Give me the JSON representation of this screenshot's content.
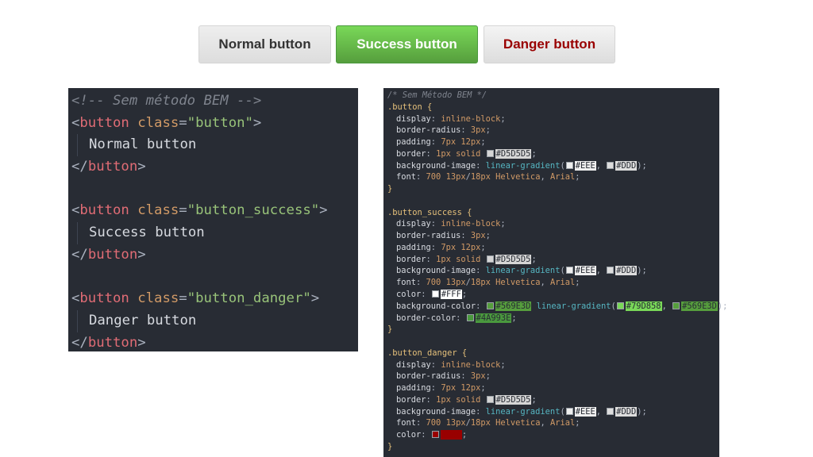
{
  "buttons": {
    "normal": "Normal button",
    "success": "Success button",
    "danger": "Danger button"
  },
  "html_code": [
    {
      "indent": false,
      "parts": [
        {
          "c": "c-comment",
          "t": "<!-- Sem método BEM -->"
        }
      ]
    },
    {
      "indent": false,
      "parts": [
        {
          "c": "c-punct",
          "t": "<"
        },
        {
          "c": "c-tag",
          "t": "button"
        },
        {
          "c": "c-text",
          "t": " "
        },
        {
          "c": "c-attr",
          "t": "class"
        },
        {
          "c": "c-punct",
          "t": "="
        },
        {
          "c": "c-str",
          "t": "\"button\""
        },
        {
          "c": "c-punct",
          "t": ">"
        }
      ]
    },
    {
      "indent": true,
      "parts": [
        {
          "c": "c-text",
          "t": "Normal button"
        }
      ]
    },
    {
      "indent": false,
      "parts": [
        {
          "c": "c-punct",
          "t": "</"
        },
        {
          "c": "c-tag",
          "t": "button"
        },
        {
          "c": "c-punct",
          "t": ">"
        }
      ]
    },
    {
      "indent": false,
      "parts": []
    },
    {
      "indent": false,
      "parts": [
        {
          "c": "c-punct",
          "t": "<"
        },
        {
          "c": "c-tag",
          "t": "button"
        },
        {
          "c": "c-text",
          "t": " "
        },
        {
          "c": "c-attr",
          "t": "class"
        },
        {
          "c": "c-punct",
          "t": "="
        },
        {
          "c": "c-str",
          "t": "\"button_success\""
        },
        {
          "c": "c-punct",
          "t": ">"
        }
      ]
    },
    {
      "indent": true,
      "parts": [
        {
          "c": "c-text",
          "t": "Success button"
        }
      ]
    },
    {
      "indent": false,
      "parts": [
        {
          "c": "c-punct",
          "t": "</"
        },
        {
          "c": "c-tag",
          "t": "button"
        },
        {
          "c": "c-punct",
          "t": ">"
        }
      ]
    },
    {
      "indent": false,
      "parts": []
    },
    {
      "indent": false,
      "parts": [
        {
          "c": "c-punct",
          "t": "<"
        },
        {
          "c": "c-tag",
          "t": "button"
        },
        {
          "c": "c-text",
          "t": " "
        },
        {
          "c": "c-attr",
          "t": "class"
        },
        {
          "c": "c-punct",
          "t": "="
        },
        {
          "c": "c-str",
          "t": "\"button_danger\""
        },
        {
          "c": "c-punct",
          "t": ">"
        }
      ]
    },
    {
      "indent": true,
      "parts": [
        {
          "c": "c-text",
          "t": "Danger button"
        }
      ]
    },
    {
      "indent": false,
      "parts": [
        {
          "c": "c-punct",
          "t": "</"
        },
        {
          "c": "c-tag",
          "t": "button"
        },
        {
          "c": "c-punct",
          "t": ">"
        }
      ]
    }
  ],
  "css_code": [
    {
      "prop": false,
      "parts": [
        {
          "c": "k-comment",
          "t": "/* Sem Método BEM */"
        }
      ]
    },
    {
      "prop": false,
      "parts": [
        {
          "c": "k-sel",
          "t": ".button"
        },
        {
          "c": "k-brace",
          "t": " {"
        }
      ]
    },
    {
      "prop": true,
      "parts": [
        {
          "c": "k-prop",
          "t": "display"
        },
        {
          "c": "k-punc",
          "t": ": "
        },
        {
          "c": "k-val",
          "t": "inline-block"
        },
        {
          "c": "k-punc",
          "t": ";"
        }
      ]
    },
    {
      "prop": true,
      "parts": [
        {
          "c": "k-prop",
          "t": "border-radius"
        },
        {
          "c": "k-punc",
          "t": ": "
        },
        {
          "c": "k-num",
          "t": "3px"
        },
        {
          "c": "k-punc",
          "t": ";"
        }
      ]
    },
    {
      "prop": true,
      "parts": [
        {
          "c": "k-prop",
          "t": "padding"
        },
        {
          "c": "k-punc",
          "t": ": "
        },
        {
          "c": "k-num",
          "t": "7px 12px"
        },
        {
          "c": "k-punc",
          "t": ";"
        }
      ]
    },
    {
      "prop": true,
      "parts": [
        {
          "c": "k-prop",
          "t": "border"
        },
        {
          "c": "k-punc",
          "t": ": "
        },
        {
          "c": "k-num",
          "t": "1px"
        },
        {
          "c": "k-val",
          "t": " solid "
        },
        {
          "sw": "#D5D5D5",
          "t": "#D5D5D5"
        },
        {
          "c": "k-punc",
          "t": ";"
        }
      ]
    },
    {
      "prop": true,
      "parts": [
        {
          "c": "k-prop",
          "t": "background-image"
        },
        {
          "c": "k-punc",
          "t": ": "
        },
        {
          "c": "k-fn",
          "t": "linear-gradient"
        },
        {
          "c": "k-punc",
          "t": "("
        },
        {
          "sw": "#EEEEEE",
          "t": "#EEE"
        },
        {
          "c": "k-punc",
          "t": ", "
        },
        {
          "sw": "#DDDDDD",
          "t": "#DDD"
        },
        {
          "c": "k-punc",
          "t": ");"
        }
      ]
    },
    {
      "prop": true,
      "parts": [
        {
          "c": "k-prop",
          "t": "font"
        },
        {
          "c": "k-punc",
          "t": ": "
        },
        {
          "c": "k-num",
          "t": "700 13px"
        },
        {
          "c": "k-punc",
          "t": "/"
        },
        {
          "c": "k-num",
          "t": "18px"
        },
        {
          "c": "k-val",
          "t": " Helvetica"
        },
        {
          "c": "k-punc",
          "t": ", "
        },
        {
          "c": "k-val",
          "t": "Arial"
        },
        {
          "c": "k-punc",
          "t": ";"
        }
      ]
    },
    {
      "prop": false,
      "parts": [
        {
          "c": "k-brace",
          "t": "}"
        }
      ]
    },
    {
      "prop": false,
      "parts": []
    },
    {
      "prop": false,
      "parts": [
        {
          "c": "k-sel",
          "t": ".button_success"
        },
        {
          "c": "k-brace",
          "t": " {"
        }
      ]
    },
    {
      "prop": true,
      "parts": [
        {
          "c": "k-prop",
          "t": "display"
        },
        {
          "c": "k-punc",
          "t": ": "
        },
        {
          "c": "k-val",
          "t": "inline-block"
        },
        {
          "c": "k-punc",
          "t": ";"
        }
      ]
    },
    {
      "prop": true,
      "parts": [
        {
          "c": "k-prop",
          "t": "border-radius"
        },
        {
          "c": "k-punc",
          "t": ": "
        },
        {
          "c": "k-num",
          "t": "3px"
        },
        {
          "c": "k-punc",
          "t": ";"
        }
      ]
    },
    {
      "prop": true,
      "parts": [
        {
          "c": "k-prop",
          "t": "padding"
        },
        {
          "c": "k-punc",
          "t": ": "
        },
        {
          "c": "k-num",
          "t": "7px 12px"
        },
        {
          "c": "k-punc",
          "t": ";"
        }
      ]
    },
    {
      "prop": true,
      "parts": [
        {
          "c": "k-prop",
          "t": "border"
        },
        {
          "c": "k-punc",
          "t": ": "
        },
        {
          "c": "k-num",
          "t": "1px"
        },
        {
          "c": "k-val",
          "t": " solid "
        },
        {
          "sw": "#D5D5D5",
          "t": "#D5D5D5"
        },
        {
          "c": "k-punc",
          "t": ";"
        }
      ]
    },
    {
      "prop": true,
      "parts": [
        {
          "c": "k-prop",
          "t": "background-image"
        },
        {
          "c": "k-punc",
          "t": ": "
        },
        {
          "c": "k-fn",
          "t": "linear-gradient"
        },
        {
          "c": "k-punc",
          "t": "("
        },
        {
          "sw": "#EEEEEE",
          "t": "#EEE"
        },
        {
          "c": "k-punc",
          "t": ", "
        },
        {
          "sw": "#DDDDDD",
          "t": "#DDD"
        },
        {
          "c": "k-punc",
          "t": ");"
        }
      ]
    },
    {
      "prop": true,
      "parts": [
        {
          "c": "k-prop",
          "t": "font"
        },
        {
          "c": "k-punc",
          "t": ": "
        },
        {
          "c": "k-num",
          "t": "700 13px"
        },
        {
          "c": "k-punc",
          "t": "/"
        },
        {
          "c": "k-num",
          "t": "18px"
        },
        {
          "c": "k-val",
          "t": " Helvetica"
        },
        {
          "c": "k-punc",
          "t": ", "
        },
        {
          "c": "k-val",
          "t": "Arial"
        },
        {
          "c": "k-punc",
          "t": ";"
        }
      ]
    },
    {
      "prop": true,
      "parts": [
        {
          "c": "k-prop",
          "t": "color"
        },
        {
          "c": "k-punc",
          "t": ": "
        },
        {
          "sw": "#FFFFFF",
          "t": "#FFF"
        },
        {
          "c": "k-punc",
          "t": ";"
        }
      ]
    },
    {
      "prop": true,
      "parts": [
        {
          "c": "k-prop",
          "t": "background-color"
        },
        {
          "c": "k-punc",
          "t": ": "
        },
        {
          "sw": "#569E3D",
          "t": "#569E3D"
        },
        {
          "c": "k-fn",
          "t": " linear-gradient"
        },
        {
          "c": "k-punc",
          "t": "("
        },
        {
          "sw": "#79D858",
          "t": "#79D858"
        },
        {
          "c": "k-punc",
          "t": ", "
        },
        {
          "sw": "#569E3D",
          "t": "#569E3D"
        },
        {
          "c": "k-punc",
          "t": ");"
        }
      ]
    },
    {
      "prop": true,
      "parts": [
        {
          "c": "k-prop",
          "t": "border-color"
        },
        {
          "c": "k-punc",
          "t": ": "
        },
        {
          "sw": "#4A993E",
          "t": "#4A993E"
        },
        {
          "c": "k-punc",
          "t": ";"
        }
      ]
    },
    {
      "prop": false,
      "parts": [
        {
          "c": "k-brace",
          "t": "}"
        }
      ]
    },
    {
      "prop": false,
      "parts": []
    },
    {
      "prop": false,
      "parts": [
        {
          "c": "k-sel",
          "t": ".button_danger"
        },
        {
          "c": "k-brace",
          "t": " {"
        }
      ]
    },
    {
      "prop": true,
      "parts": [
        {
          "c": "k-prop",
          "t": "display"
        },
        {
          "c": "k-punc",
          "t": ": "
        },
        {
          "c": "k-val",
          "t": "inline-block"
        },
        {
          "c": "k-punc",
          "t": ";"
        }
      ]
    },
    {
      "prop": true,
      "parts": [
        {
          "c": "k-prop",
          "t": "border-radius"
        },
        {
          "c": "k-punc",
          "t": ": "
        },
        {
          "c": "k-num",
          "t": "3px"
        },
        {
          "c": "k-punc",
          "t": ";"
        }
      ]
    },
    {
      "prop": true,
      "parts": [
        {
          "c": "k-prop",
          "t": "padding"
        },
        {
          "c": "k-punc",
          "t": ": "
        },
        {
          "c": "k-num",
          "t": "7px 12px"
        },
        {
          "c": "k-punc",
          "t": ";"
        }
      ]
    },
    {
      "prop": true,
      "parts": [
        {
          "c": "k-prop",
          "t": "border"
        },
        {
          "c": "k-punc",
          "t": ": "
        },
        {
          "c": "k-num",
          "t": "1px"
        },
        {
          "c": "k-val",
          "t": " solid "
        },
        {
          "sw": "#D5D5D5",
          "t": "#D5D5D5"
        },
        {
          "c": "k-punc",
          "t": ";"
        }
      ]
    },
    {
      "prop": true,
      "parts": [
        {
          "c": "k-prop",
          "t": "background-image"
        },
        {
          "c": "k-punc",
          "t": ": "
        },
        {
          "c": "k-fn",
          "t": "linear-gradient"
        },
        {
          "c": "k-punc",
          "t": "("
        },
        {
          "sw": "#EEEEEE",
          "t": "#EEE"
        },
        {
          "c": "k-punc",
          "t": ", "
        },
        {
          "sw": "#DDDDDD",
          "t": "#DDD"
        },
        {
          "c": "k-punc",
          "t": ");"
        }
      ]
    },
    {
      "prop": true,
      "parts": [
        {
          "c": "k-prop",
          "t": "font"
        },
        {
          "c": "k-punc",
          "t": ": "
        },
        {
          "c": "k-num",
          "t": "700 13px"
        },
        {
          "c": "k-punc",
          "t": "/"
        },
        {
          "c": "k-num",
          "t": "18px"
        },
        {
          "c": "k-val",
          "t": " Helvetica"
        },
        {
          "c": "k-punc",
          "t": ", "
        },
        {
          "c": "k-val",
          "t": "Arial"
        },
        {
          "c": "k-punc",
          "t": ";"
        }
      ]
    },
    {
      "prop": true,
      "parts": [
        {
          "c": "k-prop",
          "t": "color"
        },
        {
          "c": "k-punc",
          "t": ": "
        },
        {
          "sw": "#990000",
          "t": "#900"
        },
        {
          "c": "k-punc",
          "t": ";"
        }
      ]
    },
    {
      "prop": false,
      "parts": [
        {
          "c": "k-brace",
          "t": "}"
        }
      ]
    }
  ]
}
